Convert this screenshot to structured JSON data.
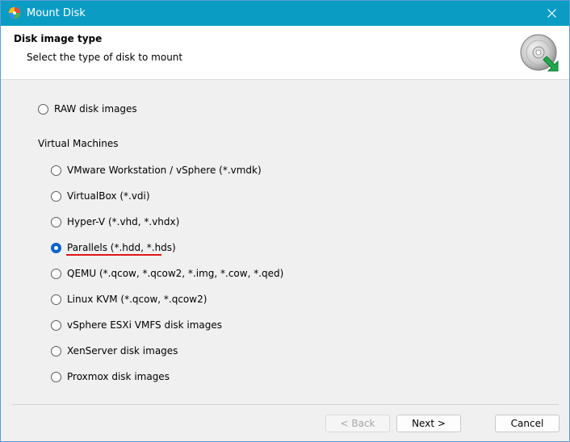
{
  "window": {
    "title": "Mount Disk",
    "accent_color": "#0b9cc4"
  },
  "header": {
    "title": "Disk image type",
    "subtitle": "Select the type of disk to mount",
    "icon": "disk-mount-icon"
  },
  "options": {
    "raw": "RAW disk images",
    "group_label": "Virtual Machines",
    "vm_items": [
      {
        "label": "VMware Workstation / vSphere (*.vmdk)",
        "checked": false
      },
      {
        "label": "VirtualBox (*.vdi)",
        "checked": false
      },
      {
        "label": "Hyper-V (*.vhd, *.vhdx)",
        "checked": false
      },
      {
        "label": "Parallels (*.hdd, *.hds)",
        "checked": true
      },
      {
        "label": "QEMU (*.qcow, *.qcow2, *.img, *.cow, *.qed)",
        "checked": false
      },
      {
        "label": "Linux KVM (*.qcow, *.qcow2)",
        "checked": false
      },
      {
        "label": "vSphere ESXi VMFS disk images",
        "checked": false
      },
      {
        "label": "XenServer disk images",
        "checked": false
      },
      {
        "label": "Proxmox disk images",
        "checked": false
      }
    ],
    "selected": "Parallels (*.hdd, *.hds)",
    "highlight_color": "#e0161a"
  },
  "footer": {
    "back_label": "< Back",
    "next_label": "Next >",
    "cancel_label": "Cancel"
  }
}
